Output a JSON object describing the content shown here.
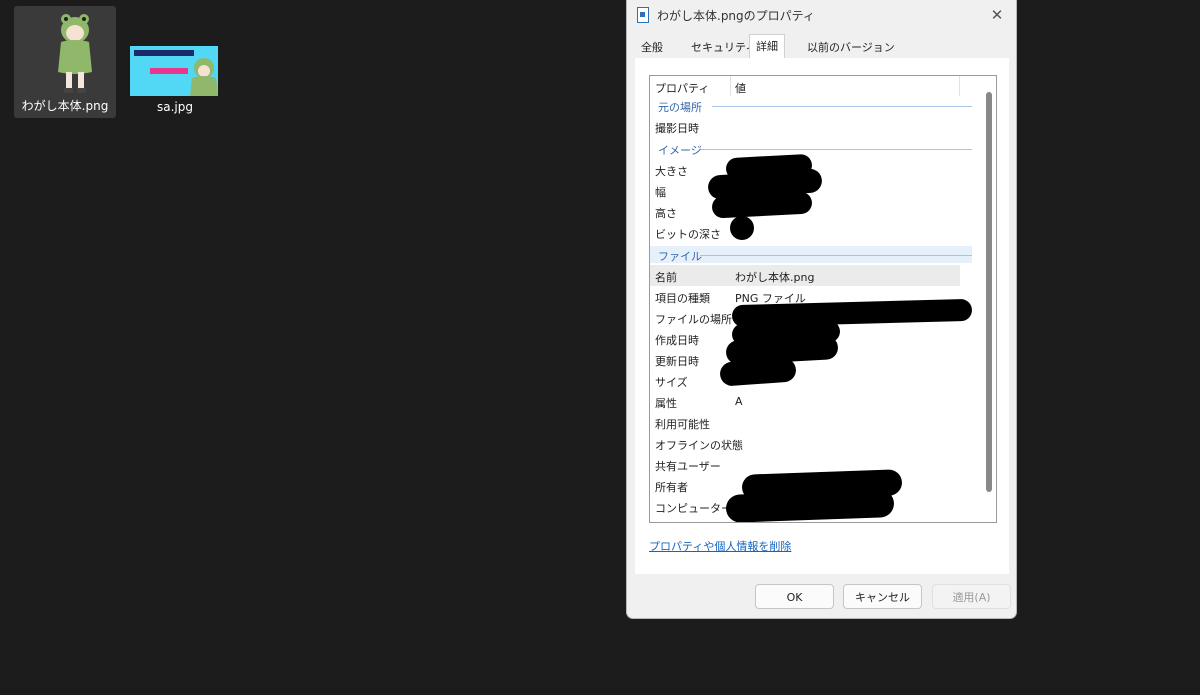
{
  "desktop": {
    "icons": [
      {
        "label": "わがし本体.png"
      },
      {
        "label": "sa.jpg"
      }
    ]
  },
  "dialog": {
    "title": "わがし本体.pngのプロパティ",
    "tabs": [
      {
        "label": "全般"
      },
      {
        "label": "セキュリティ"
      },
      {
        "label": "詳細",
        "active": true
      },
      {
        "label": "以前のバージョン"
      }
    ],
    "list": {
      "header_property": "プロパティ",
      "header_value": "値",
      "groups": {
        "origin": "元の場所",
        "image": "イメージ",
        "file": "ファイル"
      },
      "rows": {
        "taken": {
          "key": "撮影日時",
          "value": ""
        },
        "dimensions": {
          "key": "大きさ",
          "value": ""
        },
        "width": {
          "key": "幅",
          "value": ""
        },
        "height": {
          "key": "高さ",
          "value": ""
        },
        "bitdepth": {
          "key": "ビットの深さ",
          "value": ""
        },
        "name": {
          "key": "名前",
          "value": "わがし本体.png"
        },
        "type": {
          "key": "項目の種類",
          "value": "PNG ファイル"
        },
        "location": {
          "key": "ファイルの場所",
          "value": ""
        },
        "created": {
          "key": "作成日時",
          "value": ""
        },
        "modified": {
          "key": "更新日時",
          "value": ""
        },
        "size": {
          "key": "サイズ",
          "value": ""
        },
        "attributes": {
          "key": "属性",
          "value": "A"
        },
        "availability": {
          "key": "利用可能性",
          "value": ""
        },
        "offline": {
          "key": "オフラインの状態",
          "value": ""
        },
        "shared": {
          "key": "共有ユーザー",
          "value": ""
        },
        "owner": {
          "key": "所有者",
          "value": ""
        },
        "computer": {
          "key": "コンピューター",
          "value": ""
        }
      }
    },
    "remove_link": "プロパティや個人情報を削除",
    "buttons": {
      "ok": "OK",
      "cancel": "キャンセル",
      "apply": "適用(A)"
    }
  },
  "colors": {
    "desktop_bg": "#1c1c1c",
    "dialog_bg": "#f0f0f0",
    "group_text": "#3567a8",
    "link": "#1565c0",
    "redaction": "#000000"
  }
}
